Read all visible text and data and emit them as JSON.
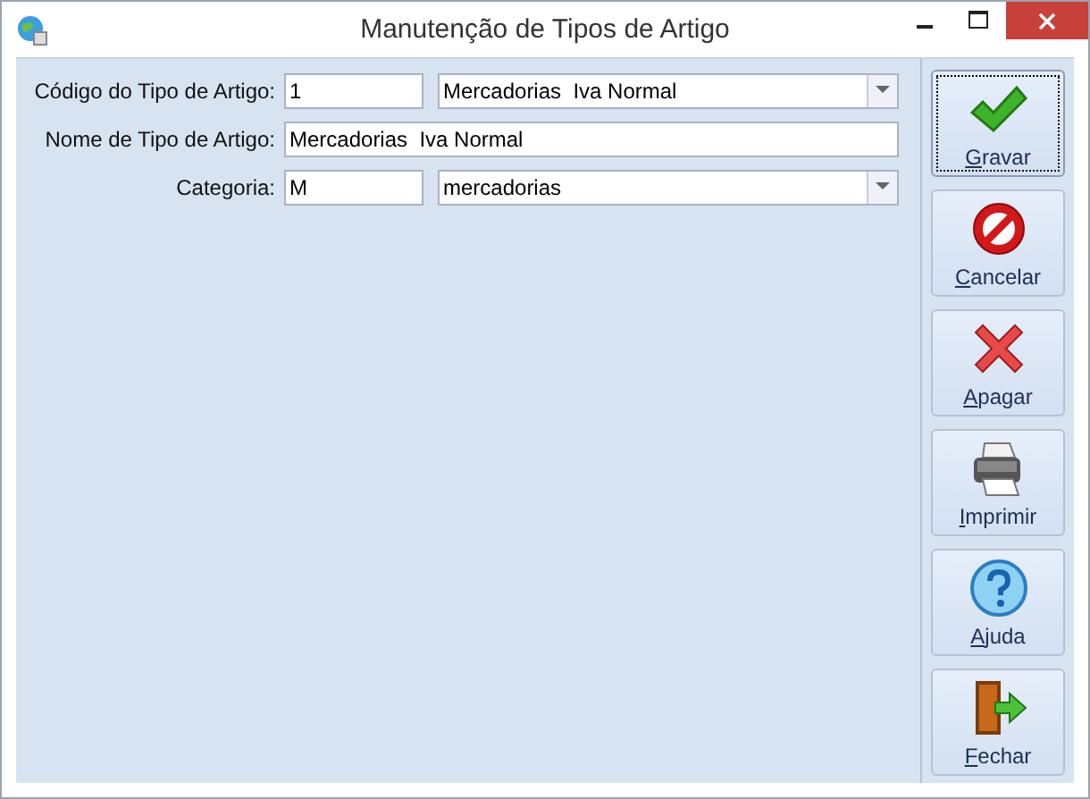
{
  "window": {
    "title": "Manutenção de Tipos de Artigo"
  },
  "form": [
    {
      "kind": "code-combo",
      "label": "Código do Tipo de Artigo:",
      "code": "1",
      "value": "Mercadorias  Iva Normal"
    },
    {
      "kind": "text",
      "label": "Nome de Tipo de Artigo:",
      "value": "Mercadorias  Iva Normal"
    },
    {
      "kind": "code-combo",
      "label": "Categoria:",
      "code": "M",
      "value": "mercadorias"
    }
  ],
  "buttons": [
    {
      "kind": "check",
      "label": "Gravar",
      "focused": true
    },
    {
      "kind": "no",
      "label": "Cancelar",
      "focused": false
    },
    {
      "kind": "x",
      "label": "Apagar",
      "focused": false
    },
    {
      "kind": "printer",
      "label": "Imprimir",
      "focused": false
    },
    {
      "kind": "help",
      "label": "Ajuda",
      "focused": false
    },
    {
      "kind": "door",
      "label": "Fechar",
      "focused": false
    }
  ]
}
